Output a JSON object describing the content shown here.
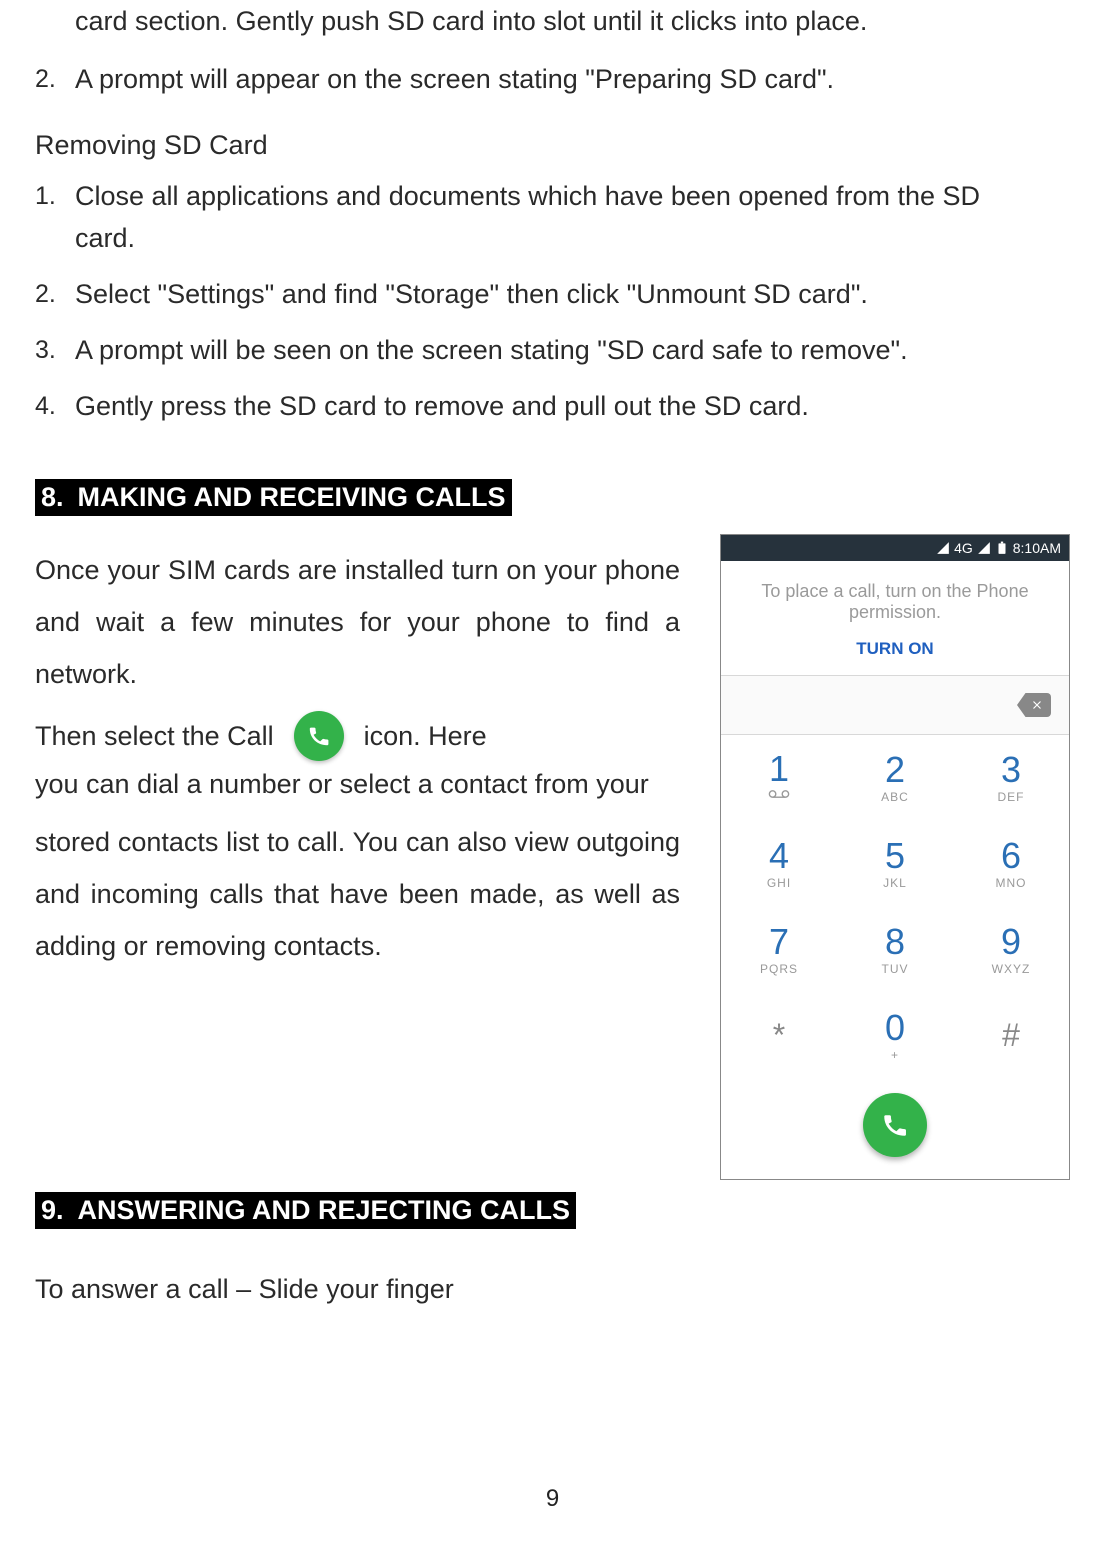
{
  "continued_list": {
    "item1_cont": "card section. Gently push SD card into slot until it clicks into place.",
    "item2_num": "2.",
    "item2": "A prompt will appear on the screen stating \"Preparing SD  card\"."
  },
  "removing": {
    "heading": "Removing SD Card",
    "items": [
      {
        "num": "1.",
        "text": "Close all applications and documents which have been opened from the SD card."
      },
      {
        "num": "2.",
        "text": "Select \"Settings\" and find \"Storage\" then click \"Unmount SD  card\"."
      },
      {
        "num": "3.",
        "text": "A prompt will be seen on the screen stating \"SD card safe to remove\"."
      },
      {
        "num": "4.",
        "text": "Gently press the SD card to remove and pull out the SD  card."
      }
    ]
  },
  "section8": {
    "num": "8.",
    "title": "MAKING AND RECEIVING CALLS",
    "para1": "Once your SIM cards are installed turn on your phone and wait a few minutes for your phone to find a network.",
    "para2a": "Then select the Call ",
    "para2b": " icon. Here",
    "para2c": "you can dial a number or select a contact from  your",
    "para2d": "stored contacts list to call. You can also view outgoing and incoming calls that have been made, as well as adding or removing contacts."
  },
  "section9": {
    "num": "9.",
    "title": "ANSWERING AND REJECTING CALLS",
    "para1": "To answer a call – Slide your finger"
  },
  "phone": {
    "status": {
      "net": "4G",
      "time": "8:10AM"
    },
    "prompt": "To place a call, turn on the Phone permission.",
    "turn_on": "TURN ON",
    "keys": [
      {
        "d": "1",
        "s": ""
      },
      {
        "d": "2",
        "s": "ABC"
      },
      {
        "d": "3",
        "s": "DEF"
      },
      {
        "d": "4",
        "s": "GHI"
      },
      {
        "d": "5",
        "s": "JKL"
      },
      {
        "d": "6",
        "s": "MNO"
      },
      {
        "d": "7",
        "s": "PQRS"
      },
      {
        "d": "8",
        "s": "TUV"
      },
      {
        "d": "9",
        "s": "WXYZ"
      },
      {
        "d": "*",
        "s": ""
      },
      {
        "d": "0",
        "s": "+"
      },
      {
        "d": "#",
        "s": ""
      }
    ]
  },
  "page_number": "9"
}
